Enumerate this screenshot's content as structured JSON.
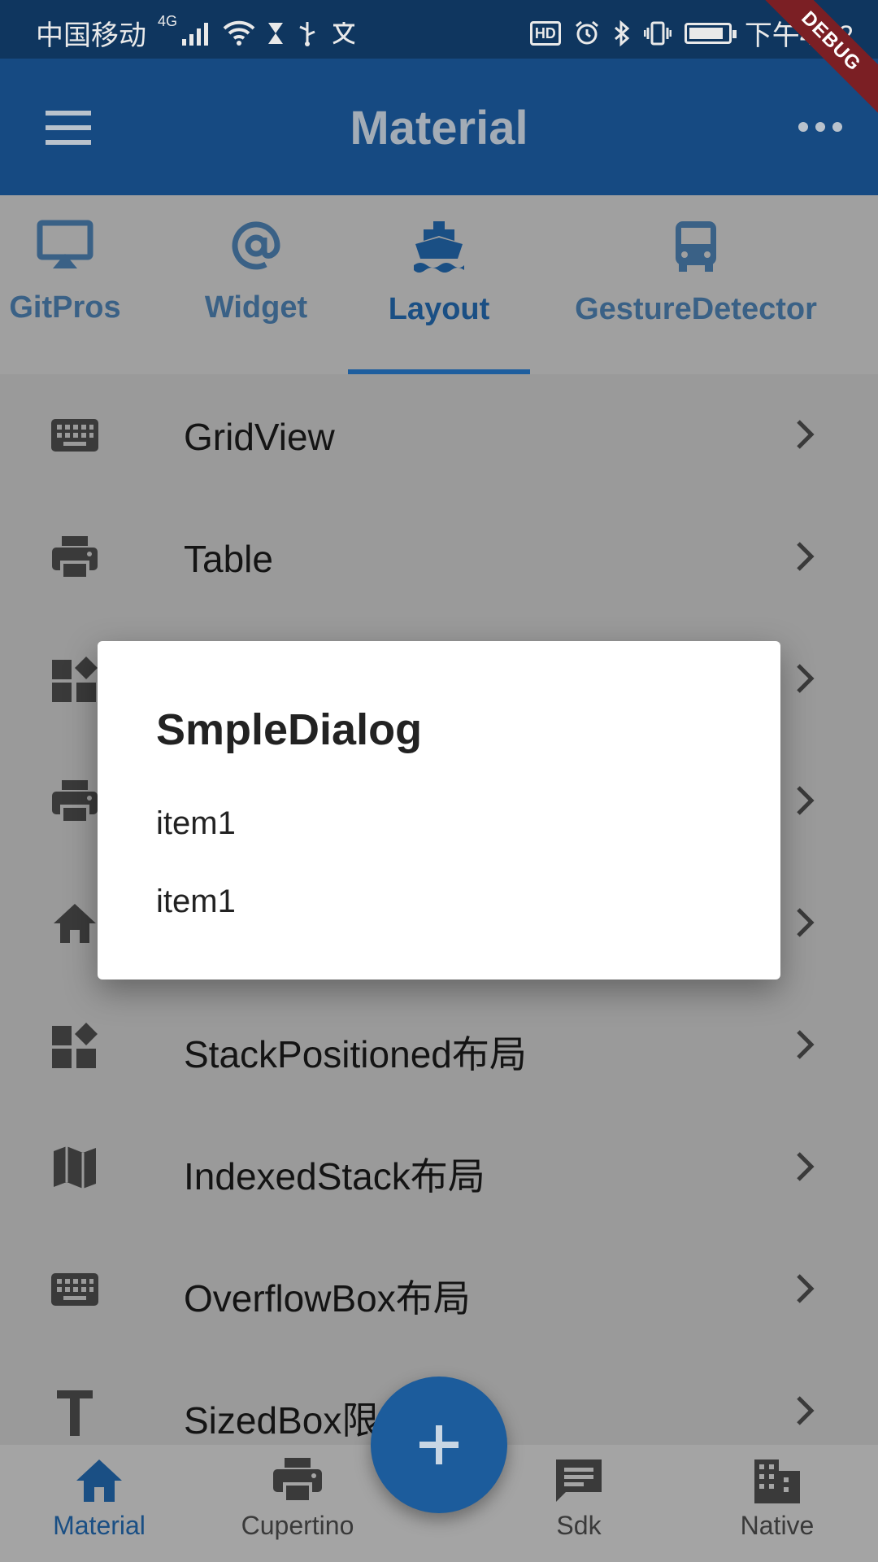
{
  "status_bar": {
    "carrier": "中国移动",
    "network": "4G",
    "time": "下午4:02",
    "hd": "HD",
    "battery_level": 0.9
  },
  "debug_banner": "DEBUG",
  "app_bar": {
    "title": "Material",
    "menu_icon": "menu-icon",
    "more_icon": "more-horiz-icon"
  },
  "tabs": [
    {
      "label": "GitPros",
      "icon": "airplay-icon"
    },
    {
      "label": "Widget",
      "icon": "at-sign-icon"
    },
    {
      "label": "Layout",
      "icon": "ship-icon",
      "active": true
    },
    {
      "label": "GestureDetector",
      "icon": "bus-icon"
    }
  ],
  "list": {
    "items": [
      {
        "label": "GridView",
        "icon": "keyboard-icon"
      },
      {
        "label": "Table",
        "icon": "print-icon"
      },
      {
        "label": "",
        "icon": "widgets-icon"
      },
      {
        "label": "",
        "icon": "print-icon"
      },
      {
        "label": "",
        "icon": "home-icon"
      },
      {
        "label": "StackPositioned布局",
        "icon": "widgets-icon"
      },
      {
        "label": "IndexedStack布局",
        "icon": "map-icon"
      },
      {
        "label": "OverflowBox布局",
        "icon": "keyboard-icon"
      },
      {
        "label": "SizedBox限",
        "icon": "text-icon"
      }
    ]
  },
  "dialog": {
    "title": "SmpleDialog",
    "items": [
      "item1",
      "item1"
    ]
  },
  "fab": {
    "icon": "add-icon"
  },
  "bottom_nav": [
    {
      "label": "Material",
      "icon": "home-icon",
      "active": true
    },
    {
      "label": "Cupertino",
      "icon": "print-icon"
    },
    {
      "label": "Sdk",
      "icon": "message-icon"
    },
    {
      "label": "Native",
      "icon": "business-icon"
    }
  ],
  "colors": {
    "primary": "#164a82",
    "status_bar": "#0f365f",
    "accent": "#1c5c9c",
    "scrim": "#9a9a9a",
    "debug": "#7b1f24"
  }
}
